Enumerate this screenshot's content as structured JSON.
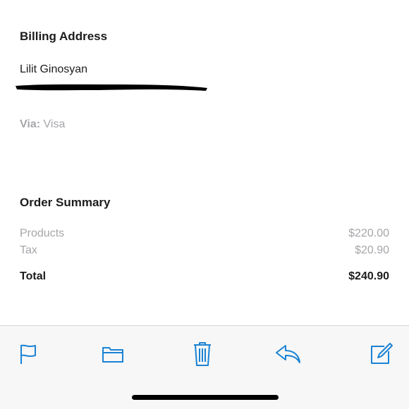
{
  "billing": {
    "title": "Billing Address",
    "name": "Lilit Ginosyan",
    "via_label": "Via:",
    "via_value": "Visa"
  },
  "order_summary": {
    "title": "Order Summary",
    "products_label": "Products",
    "products_value": "$220.00",
    "tax_label": "Tax",
    "tax_value": "$20.90",
    "total_label": "Total",
    "total_value": "$240.90"
  },
  "toolbar": {
    "icons": [
      "flag-icon",
      "folder-icon",
      "trash-icon",
      "reply-icon",
      "compose-icon"
    ],
    "accent_color": "#1a82d4"
  }
}
